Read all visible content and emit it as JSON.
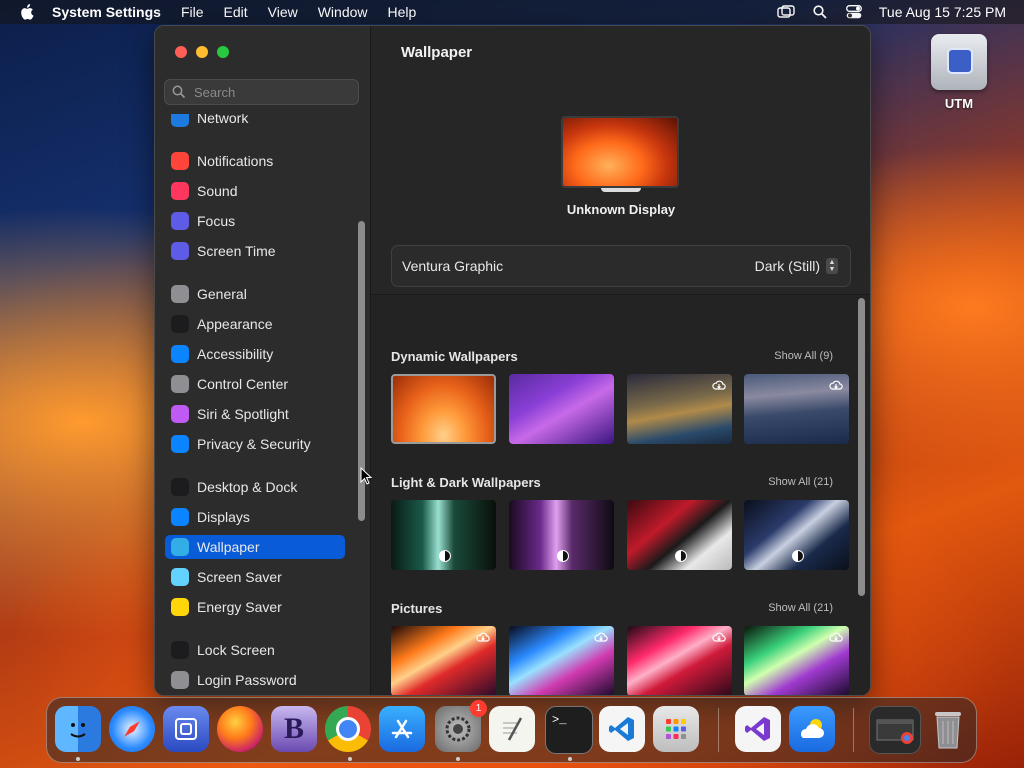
{
  "menubar": {
    "app_name": "System Settings",
    "menus": [
      "File",
      "Edit",
      "View",
      "Window",
      "Help"
    ],
    "datetime": "Tue Aug 15  7:25 PM",
    "icons": [
      "apple-icon",
      "screen-mirroring-icon",
      "spotlight-search-icon",
      "control-center-icon"
    ]
  },
  "desktop": {
    "utm_label": "UTM"
  },
  "window": {
    "search_placeholder": "Search",
    "sidebar": {
      "groups": [
        {
          "items": [
            {
              "label": "Network",
              "color": "#1f7ae0",
              "icon": "globe-icon"
            }
          ]
        },
        {
          "items": [
            {
              "label": "Notifications",
              "color": "#ff453a",
              "icon": "bell-icon"
            },
            {
              "label": "Sound",
              "color": "#ff375f",
              "icon": "speaker-icon"
            },
            {
              "label": "Focus",
              "color": "#5e5ce6",
              "icon": "moon-icon"
            },
            {
              "label": "Screen Time",
              "color": "#5e5ce6",
              "icon": "hourglass-icon"
            }
          ]
        },
        {
          "items": [
            {
              "label": "General",
              "color": "#8e8e93",
              "icon": "gear-icon"
            },
            {
              "label": "Appearance",
              "color": "#1c1c1e",
              "icon": "appearance-icon"
            },
            {
              "label": "Accessibility",
              "color": "#0a84ff",
              "icon": "accessibility-icon"
            },
            {
              "label": "Control Center",
              "color": "#8e8e93",
              "icon": "control-center-icon"
            },
            {
              "label": "Siri & Spotlight",
              "color": "#bf5af2",
              "icon": "siri-icon"
            },
            {
              "label": "Privacy & Security",
              "color": "#0a84ff",
              "icon": "hand-icon"
            }
          ]
        },
        {
          "items": [
            {
              "label": "Desktop & Dock",
              "color": "#1c1c1e",
              "icon": "dock-icon"
            },
            {
              "label": "Displays",
              "color": "#0a84ff",
              "icon": "sun-icon"
            },
            {
              "label": "Wallpaper",
              "color": "#32ade6",
              "icon": "flower-icon",
              "selected": true
            },
            {
              "label": "Screen Saver",
              "color": "#64d2ff",
              "icon": "screen-saver-icon"
            },
            {
              "label": "Energy Saver",
              "color": "#ffd60a",
              "icon": "lightbulb-icon"
            }
          ]
        },
        {
          "items": [
            {
              "label": "Lock Screen",
              "color": "#1c1c1e",
              "icon": "lock-icon"
            },
            {
              "label": "Login Password",
              "color": "#8e8e93",
              "icon": "lock-icon"
            }
          ]
        }
      ]
    },
    "main": {
      "title": "Wallpaper",
      "display_name": "Unknown Display",
      "wallpaper_name": "Ventura Graphic",
      "appearance_value": "Dark (Still)",
      "sections": [
        {
          "title": "Dynamic Wallpapers",
          "show_all": "Show All (9)",
          "type": "dynamic"
        },
        {
          "title": "Light & Dark Wallpapers",
          "show_all": "Show All (21)",
          "type": "lightdark"
        },
        {
          "title": "Pictures",
          "show_all": "Show All (21)",
          "type": "pictures"
        }
      ]
    }
  },
  "dock": {
    "apps": [
      "finder-icon",
      "safari-icon",
      "utm-icon",
      "firefox-icon",
      "bbedit-icon",
      "chrome-icon",
      "app-store-icon",
      "system-settings-icon",
      "textedit-icon",
      "terminal-icon",
      "vscode-icon",
      "launchpad-icon",
      "visual-studio-icon",
      "weather-icon",
      "minimized-window-icon",
      "trash-icon"
    ],
    "system_settings_badge": "1"
  }
}
